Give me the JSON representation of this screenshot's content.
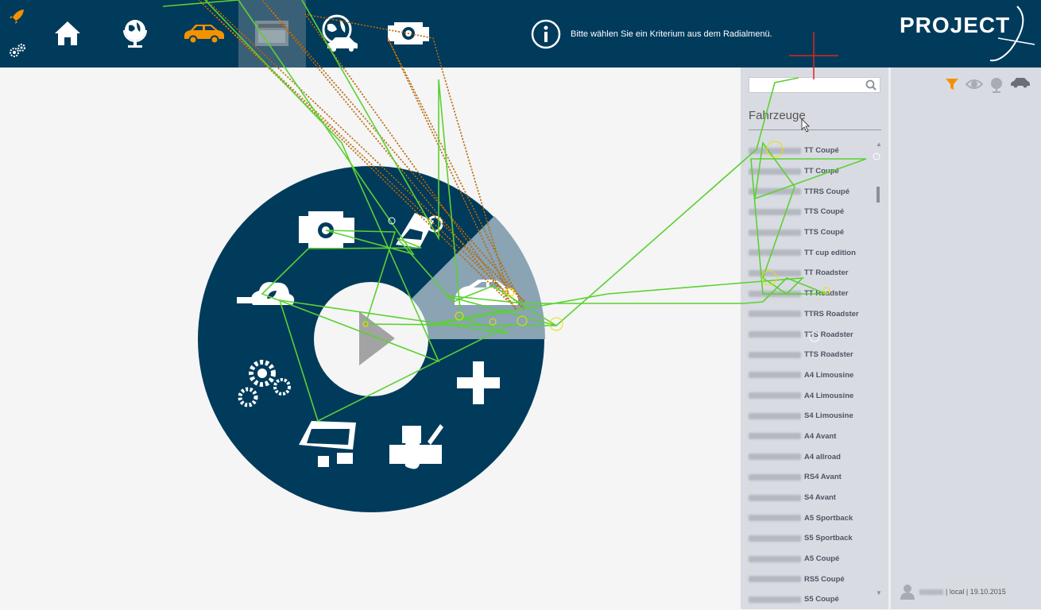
{
  "topbar": {
    "info_text": "Bitte wählen Sie ein Kriterium aus dem Radialmenü.",
    "logo_text": "PROJECT",
    "nav": [
      "home-icon",
      "globe-icon",
      "car-icon",
      "grid-calendar-icon",
      "globe-car-icon",
      "engine-icon"
    ],
    "colors": {
      "bg": "#003b5c",
      "active": "#3a6078",
      "accent": "#f39200"
    }
  },
  "list": {
    "title": "Fahrzeuge",
    "search_placeholder": "",
    "items": [
      "TT Coupé",
      "TT Coupé",
      "TTRS Coupé",
      "TTS Coupé",
      "TTS Coupé",
      "TT cup edition",
      "TT Roadster",
      "TT Roadster",
      "TTRS Roadster",
      "TTS Roadster",
      "TTS Roadster",
      "A4 Limousine",
      "A4 Limousine",
      "S4 Limousine",
      "A4 Avant",
      "A4 allroad",
      "RS4 Avant",
      "S4 Avant",
      "A5 Sportback",
      "S5 Sportback",
      "A5 Coupé",
      "RS5 Coupé",
      "S5 Coupé"
    ]
  },
  "footer": {
    "suffix": "| local | 19.10.2015"
  },
  "radial": {
    "items": [
      "engine-icon",
      "car-key-icon",
      "car-icon",
      "eco-cloud-icon",
      "gears-icon",
      "building-blocks-icon",
      "puzzle-pen-icon",
      "plus-icon",
      "play-button"
    ],
    "colors": {
      "ring": "#003b5c",
      "highlight": "#8aa4b4",
      "center": "#f5f5f5",
      "play": "#a0a0a0"
    }
  },
  "filters": [
    "filter-icon",
    "eye-icon",
    "globe-icon",
    "car-icon"
  ]
}
